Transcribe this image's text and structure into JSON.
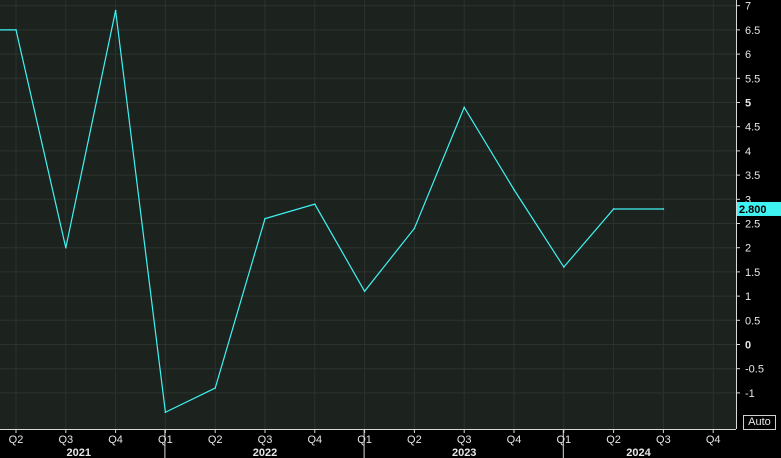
{
  "chart_data": {
    "type": "line",
    "x": [
      "2021 Q2",
      "2021 Q3",
      "2021 Q4",
      "2022 Q1",
      "2022 Q2",
      "2022 Q3",
      "2022 Q4",
      "2023 Q1",
      "2023 Q2",
      "2023 Q3",
      "2023 Q4",
      "2024 Q1",
      "2024 Q2",
      "2024 Q3"
    ],
    "series": [
      {
        "values": [
          6.5,
          2.0,
          6.9,
          -1.4,
          -0.9,
          2.6,
          2.9,
          1.1,
          2.4,
          4.9,
          3.2,
          1.6,
          2.8,
          2.8
        ]
      }
    ],
    "leading_value": 6.5,
    "ylim": [
      -1.5,
      7
    ],
    "y_ticks": [
      {
        "label": "7",
        "value": 7
      },
      {
        "label": "6.5",
        "value": 6.5
      },
      {
        "label": "6",
        "value": 6
      },
      {
        "label": "5.5",
        "value": 5.5
      },
      {
        "label": "5",
        "value": 5,
        "bold": true
      },
      {
        "label": "4.5",
        "value": 4.5
      },
      {
        "label": "4",
        "value": 4
      },
      {
        "label": "3.5",
        "value": 3.5
      },
      {
        "label": "3",
        "value": 3
      },
      {
        "label": "2.5",
        "value": 2.5
      },
      {
        "label": "2",
        "value": 2
      },
      {
        "label": "1.5",
        "value": 1.5
      },
      {
        "label": "1",
        "value": 1
      },
      {
        "label": "0.5",
        "value": 0.5
      },
      {
        "label": "0",
        "value": 0,
        "bold": true
      },
      {
        "label": "-0.5",
        "value": -0.5
      },
      {
        "label": "-1",
        "value": -1
      }
    ],
    "x_tick_labels": [
      "Q2",
      "Q3",
      "Q4",
      "Q1",
      "Q2",
      "Q3",
      "Q4",
      "Q1",
      "Q2",
      "Q3",
      "Q4",
      "Q1",
      "Q2",
      "Q3",
      "Q4"
    ],
    "years": [
      "2021",
      "2022",
      "2023",
      "2024"
    ],
    "last_value_label": "2.800",
    "grid": true,
    "colors": {
      "line": "#3ff3f3",
      "plot_background": "#1c221e",
      "grid": "#2c332e",
      "last_value_bg": "#3ff3f3",
      "text": "#e6e6e6"
    }
  },
  "controls": {
    "auto_label": "Auto"
  }
}
